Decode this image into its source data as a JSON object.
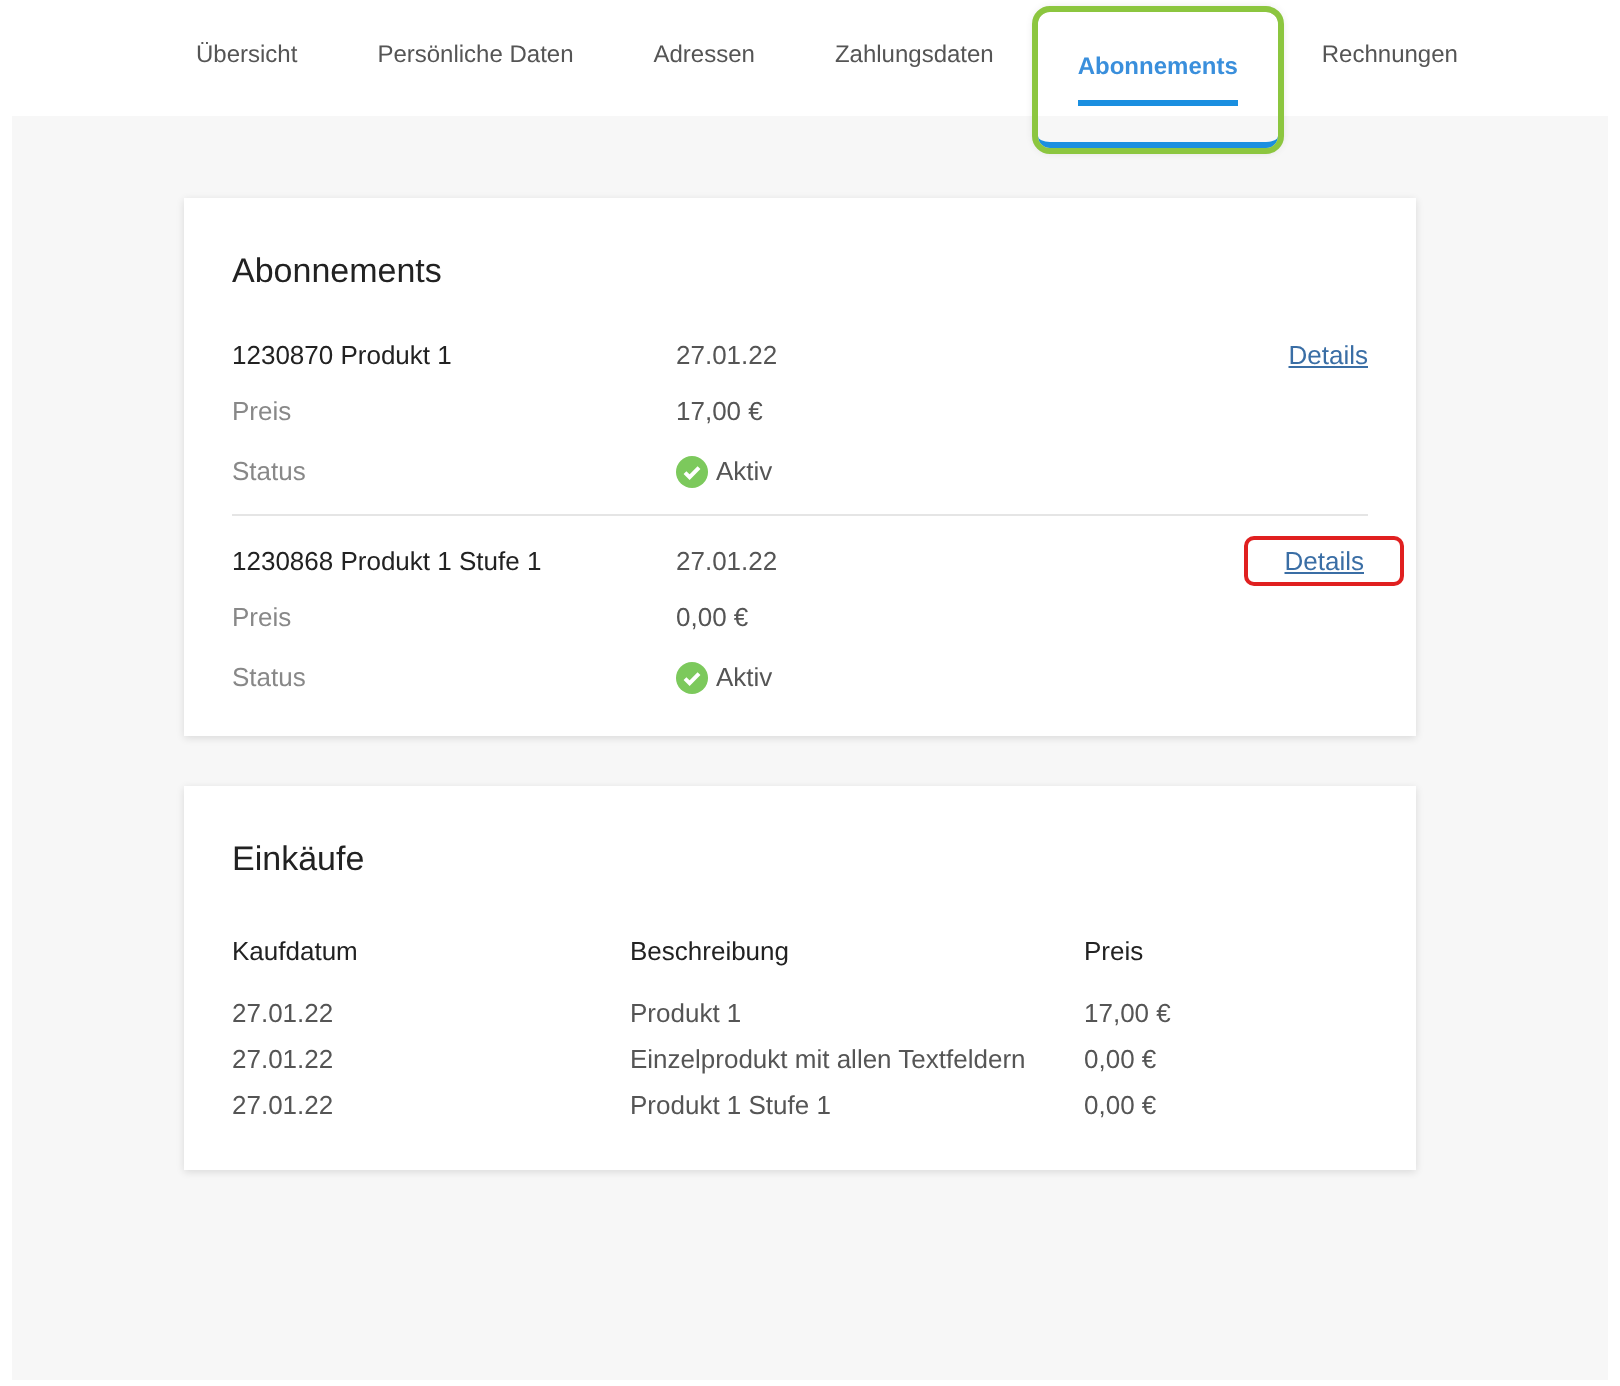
{
  "tabs": [
    {
      "label": "Übersicht",
      "selected": false,
      "highlighted": false
    },
    {
      "label": "Persönliche Daten",
      "selected": false,
      "highlighted": false
    },
    {
      "label": "Adressen",
      "selected": false,
      "highlighted": false
    },
    {
      "label": "Zahlungsdaten",
      "selected": false,
      "highlighted": false
    },
    {
      "label": "Abonnements",
      "selected": true,
      "highlighted": true
    },
    {
      "label": "Rechnungen",
      "selected": false,
      "highlighted": false
    }
  ],
  "subscriptions": {
    "title": "Abonnements",
    "items": [
      {
        "name": "1230870 Produkt 1",
        "date": "27.01.22",
        "link": "Details",
        "link_highlighted": false,
        "price_label": "Preis",
        "price": "17,00 €",
        "status_label": "Status",
        "status": "Aktiv",
        "active": true
      },
      {
        "name": "1230868 Produkt 1 Stufe 1",
        "date": "27.01.22",
        "link": "Details",
        "link_highlighted": true,
        "price_label": "Preis",
        "price": "0,00 €",
        "status_label": "Status",
        "status": "Aktiv",
        "active": true
      }
    ]
  },
  "purchases": {
    "title": "Einkäufe",
    "columns": [
      "Kaufdatum",
      "Beschreibung",
      "Preis"
    ],
    "rows": [
      [
        "27.01.22",
        "Produkt 1",
        "17,00 €"
      ],
      [
        "27.01.22",
        "Einzelprodukt mit allen Textfeldern",
        "0,00 €"
      ],
      [
        "27.01.22",
        "Produkt 1 Stufe 1",
        "0,00 €"
      ]
    ]
  }
}
